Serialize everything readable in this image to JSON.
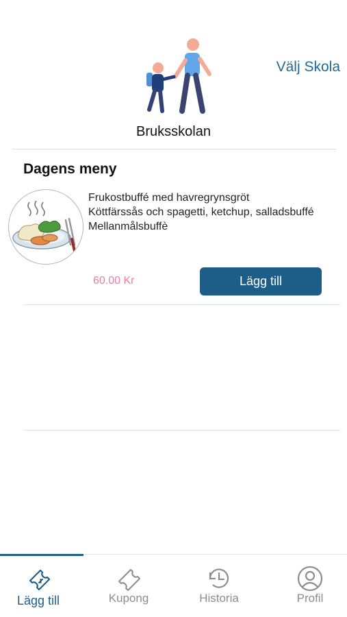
{
  "header": {
    "school_name": "Bruksskolan",
    "choose_school_label": "Välj Skola",
    "illustration": "adult-and-child-walking"
  },
  "menu": {
    "heading": "Dagens meny",
    "image": "plate-with-food-icon",
    "lines": [
      "Frukostbuffé med havregrynsgröt",
      "Köttfärssås och spagetti, ketchup, salladsbuffé",
      "Mellanmålsbuffè"
    ],
    "price": "60.00 Kr",
    "add_button_label": "Lägg till"
  },
  "tabs": [
    {
      "label": "Lägg till",
      "icon": "ticket-add-icon",
      "active": true
    },
    {
      "label": "Kupong",
      "icon": "ticket-icon",
      "active": false
    },
    {
      "label": "Historia",
      "icon": "history-clock-icon",
      "active": false
    },
    {
      "label": "Profil",
      "icon": "profile-icon",
      "active": false
    }
  ],
  "colors": {
    "accent": "#1d5e88",
    "link": "#1f6a95",
    "price": "#e77fa0",
    "inactive_tab": "#8c8c8c"
  }
}
